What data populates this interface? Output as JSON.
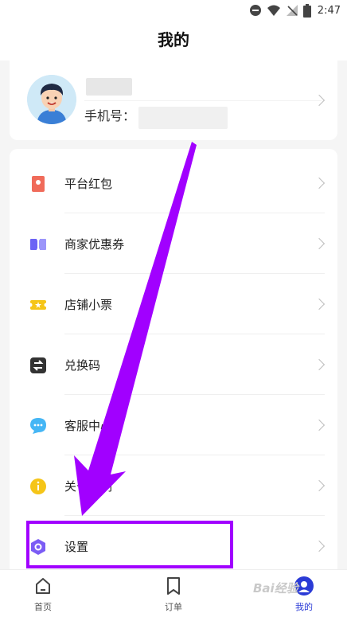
{
  "status_bar": {
    "time": "2:47",
    "icons": [
      "do-not-disturb-icon",
      "wifi-icon",
      "no-signal-icon",
      "battery-icon"
    ]
  },
  "header": {
    "title": "我的"
  },
  "profile": {
    "phone_label": "手机号：",
    "avatar_icon": "avatar-cartoon-icon"
  },
  "menu": {
    "items": [
      {
        "label": "平台红包",
        "icon": "red-packet-icon",
        "color": "#f06b5a"
      },
      {
        "label": "商家优惠券",
        "icon": "coupon-icon",
        "color": "#6c63f5"
      },
      {
        "label": "店铺小票",
        "icon": "receipt-icon",
        "color": "#f5c518"
      },
      {
        "label": "兑换码",
        "icon": "exchange-icon",
        "color": "#333333"
      },
      {
        "label": "客服中心",
        "icon": "chat-bubble-icon",
        "color": "#45b6f5"
      },
      {
        "label": "关于我们",
        "icon": "info-icon",
        "color": "#f5c518"
      },
      {
        "label": "设置",
        "icon": "settings-hexagon-icon",
        "color": "#7b5cf5"
      }
    ]
  },
  "tabs": [
    {
      "label": "首页",
      "icon": "home-icon"
    },
    {
      "label": "订单",
      "icon": "bookmark-icon"
    },
    {
      "label": "我的",
      "icon": "profile-icon",
      "active": true
    }
  ],
  "accent_color": "#2b3bd6",
  "annotation_color": "#a100ff",
  "watermark": "Bai经验"
}
